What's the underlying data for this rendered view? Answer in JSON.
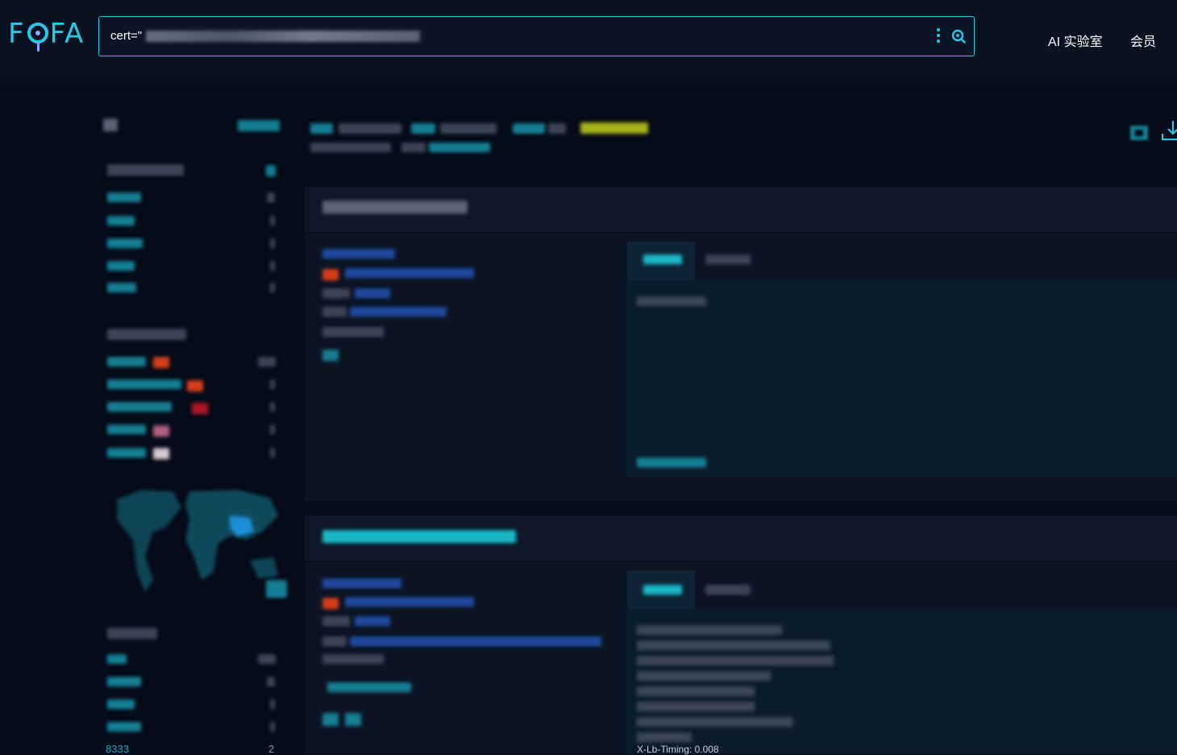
{
  "app": {
    "logo": "FOFA"
  },
  "search": {
    "query_prefix": "cert=\""
  },
  "nav": {
    "ai_lab": "AI 实验室",
    "member": "会员"
  },
  "sidebar": {
    "bottom_item_label": "8333",
    "bottom_item_count": "2"
  },
  "result": {
    "visible_header_text": "X-Lb-Timing: 0.008"
  },
  "icons": [
    "more-vertical-icon",
    "search-icon",
    "settings-icon",
    "download-icon",
    "world-map"
  ],
  "colors": {
    "accent": "#28c6e3",
    "background": "#050b18",
    "topbar": "#0a1222",
    "card": "#0c1424",
    "highlight": "#a8b21a"
  }
}
